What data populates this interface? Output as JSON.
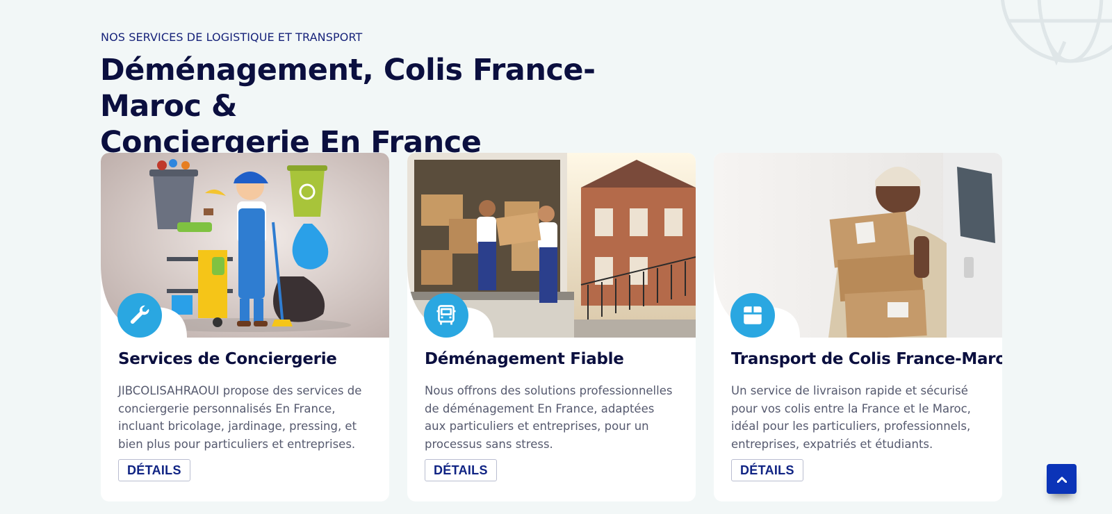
{
  "section": {
    "eyebrow": "NOS SERVICES DE LOGISTIQUE ET TRANSPORT",
    "heading_line1": "Déménagement, Colis France-Maroc &",
    "heading_line2": "Conciergerie En France"
  },
  "cards": [
    {
      "title": "Services de Conciergerie",
      "description": "JIBCOLISAHRAOUI propose des services de conciergerie personnalisés En France, incluant bricolage, jardinage, pressing, et bien plus pour particuliers et entreprises.",
      "button_label": "DÉTAILS",
      "icon": "wrench-icon",
      "image": "cleaning-worker-illustration"
    },
    {
      "title": "Déménagement Fiable",
      "description": "Nous offrons des solutions professionnelles de déménagement En France, adaptées aux particuliers et entreprises, pour un processus sans stress.",
      "button_label": "DÉTAILS",
      "icon": "truck-icon",
      "image": "movers-loading-truck-photo"
    },
    {
      "title": "Transport de Colis France-Maroc",
      "description": "Un service de livraison rapide et sécurisé pour vos colis entre la France et le Maroc, idéal pour les particuliers, professionnels, entreprises, expatriés et étudiants.",
      "button_label": "DÉTAILS",
      "icon": "box-icon",
      "image": "courier-carrying-parcels-photo"
    }
  ],
  "scroll_top": {
    "icon": "chevron-up-icon"
  },
  "colors": {
    "background": "#f2f7f7",
    "heading": "#0b0f3f",
    "eyebrow": "#17237a",
    "accent_blue": "#2aa7e1",
    "button_text": "#0f2383",
    "scroll_button": "#0b34b8"
  }
}
